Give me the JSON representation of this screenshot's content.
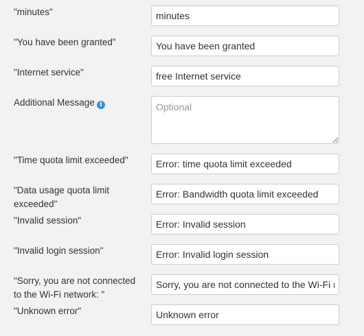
{
  "rows": [
    {
      "label": "\"minutes\"",
      "value": "minutes"
    },
    {
      "label": "\"You have been granted\"",
      "value": "You have been granted"
    },
    {
      "label": "\"Internet service\"",
      "value": "free Internet service"
    },
    {
      "label": "Additional Message",
      "value": "",
      "placeholder": "Optional",
      "icon": "info-icon"
    },
    {
      "label": "\"Time quota limit exceeded\"",
      "value": "Error: time quota limit exceeded"
    },
    {
      "label": "\"Data usage quota limit exceeded\"",
      "value": "Error: Bandwidth quota limit exceeded"
    },
    {
      "label": "\"Invalid session\"",
      "value": "Error: Invalid session"
    },
    {
      "label": "\"Invalid login session\"",
      "value": "Error: Invalid login session"
    },
    {
      "label": "\"Sorry, you are not connected to the Wi-Fi network: \"",
      "value": "Sorry, you are not connected to the Wi-Fi network"
    },
    {
      "label": "\"Unknown error\"",
      "value": "Unknown error"
    }
  ],
  "colors": {
    "background": "#f2f2f2",
    "field_border": "#cccccc",
    "info_icon": "#3a8fd4"
  }
}
